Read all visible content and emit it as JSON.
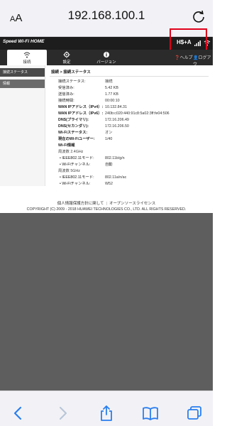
{
  "browser": {
    "aa_label": "AA",
    "url": "192.168.100.1"
  },
  "app": {
    "logo": "Speed Wi-Fi HOME",
    "network_type": "H$+A",
    "help_label": "ヘルプ",
    "logout_label": "ログアウ"
  },
  "tabs": [
    {
      "label": "接続",
      "icon": "wifi-icon"
    },
    {
      "label": "設定",
      "icon": "gear-icon"
    },
    {
      "label": "バージョン",
      "icon": "info-icon"
    }
  ],
  "sidebar": {
    "items": [
      {
        "label": "接続ステータス"
      },
      {
        "label": "情報"
      }
    ]
  },
  "main": {
    "breadcrumb": "接続 > 接続ステータス",
    "rows": [
      {
        "k": "接続ステータス:",
        "v": "接続"
      },
      {
        "k": "受信済み:",
        "v": "5.42 KB"
      },
      {
        "k": "送信済み:",
        "v": "1.77 KB"
      },
      {
        "k": "接続時間:",
        "v": "00:00:10"
      },
      {
        "k": "WAN IPアドレス（IPv4）:",
        "v": "10.132.84.31"
      },
      {
        "k": "WAN IPアドレス（IPv6）:",
        "v": "240b:c020:440:91c8:5a02:3ff:fe04:506"
      },
      {
        "k": "DNS(プライマリ):",
        "v": "172.16.206.49"
      },
      {
        "k": "DNS(セカンダリ):",
        "v": "172.16.206.50"
      },
      {
        "k": "Wi-Fiステータス:",
        "v": "オン"
      },
      {
        "k": "現在のWi-Fiユーザー:",
        "v": "1/40"
      },
      {
        "k": "Wi-Fi情報",
        "v": ""
      },
      {
        "k": "周波数 2.4GHz",
        "v": ""
      },
      {
        "k": "IEEE802.11モード:",
        "v": "802.11b/g/n"
      },
      {
        "k": "Wi-Fiチャンネル:",
        "v": "自動"
      },
      {
        "k": "周波数 5GHz",
        "v": ""
      },
      {
        "k": "IEEE802.11モード:",
        "v": "802.11a/n/ac"
      },
      {
        "k": "Wi-Fiチャンネル:",
        "v": "W52"
      }
    ]
  },
  "footer": {
    "privacy": "個人情報保護方針に関して",
    "oss": "オープンソースライセンス",
    "copyright": "COPYRIGHT (C) 2009 - 2018 HUAWEI TECHNOLOGIES CO., LTD. ALL RIGHTS RESERVED."
  },
  "colors": {
    "highlight": "#e0001b",
    "appbar": "#1d1d1d",
    "ios_blue": "#2a7ef0"
  }
}
